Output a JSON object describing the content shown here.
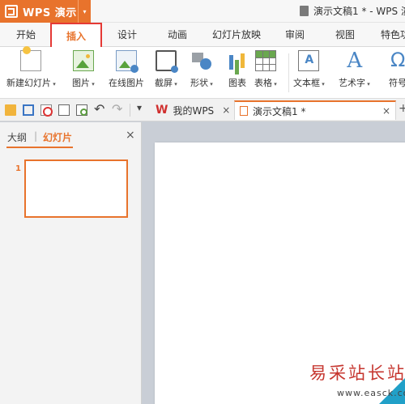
{
  "app": {
    "name": "WPS 演示",
    "menu_arrow": "▾"
  },
  "window": {
    "title": "演示文稿1 * - WPS 演"
  },
  "ribbon_tabs": [
    {
      "label": "开始"
    },
    {
      "label": "插入"
    },
    {
      "label": "设计"
    },
    {
      "label": "动画"
    },
    {
      "label": "幻灯片放映"
    },
    {
      "label": "审阅"
    },
    {
      "label": "视图"
    },
    {
      "label": "特色功"
    }
  ],
  "ribbon": {
    "new_slide": "新建幻灯片",
    "picture": "图片",
    "online_picture": "在线图片",
    "screenshot": "截屏",
    "shape": "形状",
    "chart": "图表",
    "table": "表格",
    "text_box": "文本框",
    "word_art": "艺术字",
    "symbol": "符号"
  },
  "doc_tabs": {
    "my_wps": "我的WPS",
    "current": "演示文稿1 *",
    "close": "×",
    "new_tab": "+"
  },
  "left_panel": {
    "outline_tab": "大纲",
    "divider": "|",
    "slides_tab": "幻灯片",
    "close": "×",
    "slide_number": "1"
  },
  "watermark": {
    "text": "易采站长站",
    "url": "www.easck.com"
  },
  "colors": {
    "accent": "#e8732c",
    "highlight_border": "#e53935",
    "slide_corner": "#21a0c8"
  }
}
